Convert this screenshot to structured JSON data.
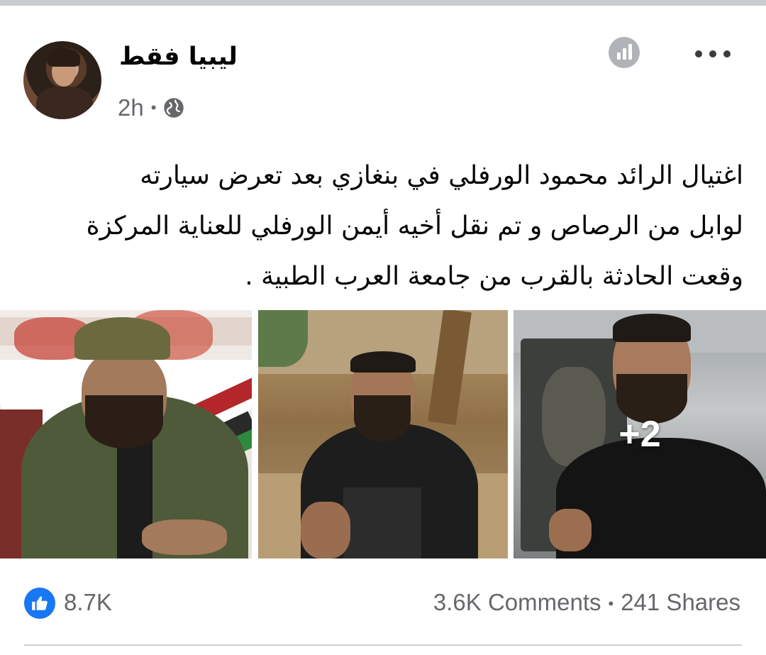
{
  "post": {
    "page_name": "ليبيا فقط",
    "time": "2h",
    "privacy_icon": "globe-icon",
    "text_lines": [
      "اغتيال الرائد محمود الورفلي في بنغازي بعد تعرض سيارته",
      "لوابل من الرصاص و تم نقل أخيه أيمن الورفلي للعناية المركزة",
      "وقعت الحادثة بالقرب من جامعة العرب الطبية ."
    ],
    "photos": {
      "more_count": "+2"
    },
    "reactions": {
      "likes": "8.7K",
      "like_color": "#1877f2"
    },
    "comments": "3.6K Comments",
    "shares": "241 Shares"
  },
  "colors": {
    "secondary_text": "#65676b",
    "primary_text": "#050505",
    "divider": "#ced0d4"
  }
}
